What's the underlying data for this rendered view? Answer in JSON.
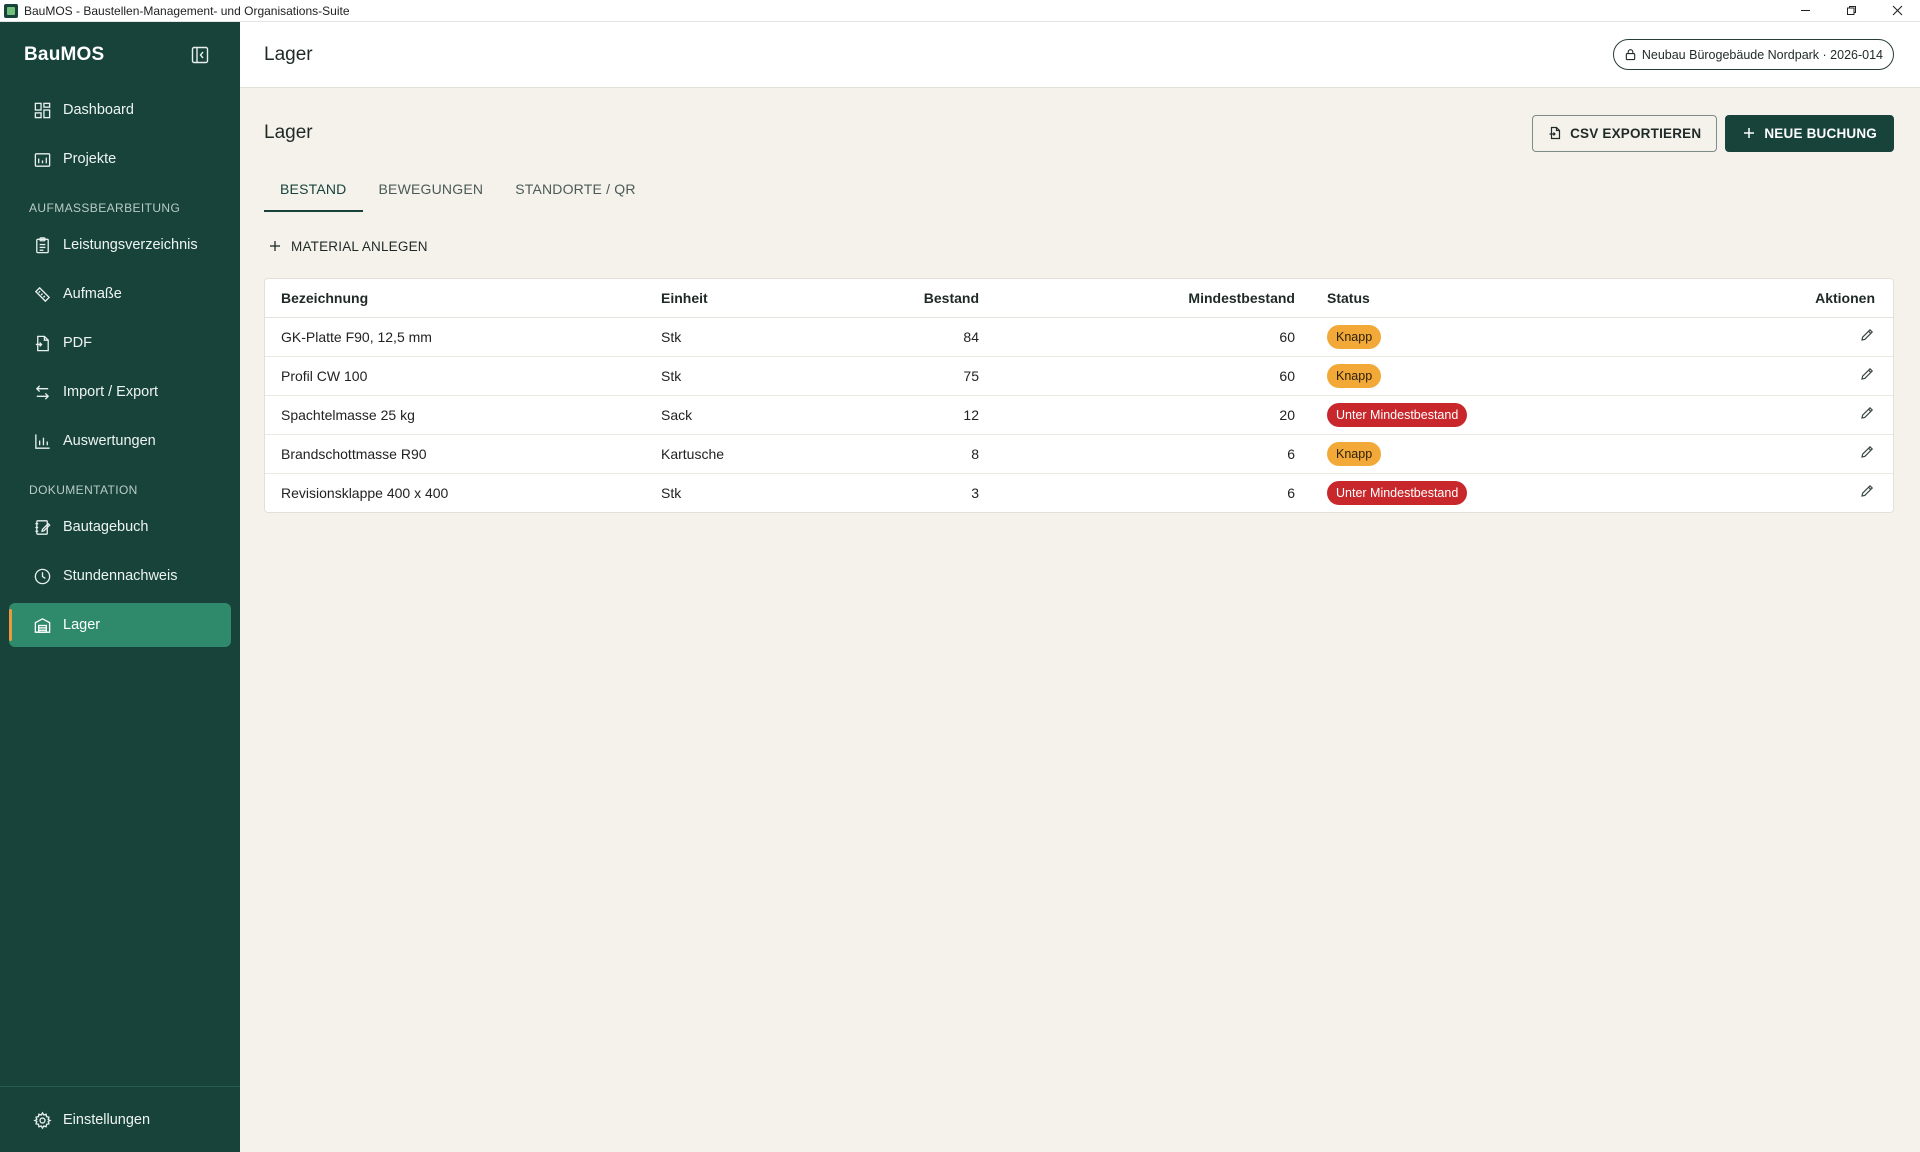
{
  "window": {
    "title": "BauMOS - Baustellen-Management- und Organisations-Suite"
  },
  "sidebar": {
    "brand": "BauMOS",
    "items_top": [
      {
        "label": "Dashboard",
        "icon": "dashboard-icon"
      },
      {
        "label": "Projekte",
        "icon": "projects-icon"
      }
    ],
    "section1": "AUFMASSBEARBEITUNG",
    "items_mid": [
      {
        "label": "Leistungsverzeichnis",
        "icon": "clipboard-icon"
      },
      {
        "label": "Aufmaße",
        "icon": "ruler-icon"
      },
      {
        "label": "PDF",
        "icon": "pdf-file-icon"
      },
      {
        "label": "Import / Export",
        "icon": "swap-arrows-icon"
      },
      {
        "label": "Auswertungen",
        "icon": "bar-chart-icon"
      }
    ],
    "section2": "DOKUMENTATION",
    "items_doc": [
      {
        "label": "Bautagebuch",
        "icon": "journal-icon"
      },
      {
        "label": "Stundennachweis",
        "icon": "clock-icon"
      },
      {
        "label": "Lager",
        "icon": "warehouse-icon",
        "active": true
      }
    ],
    "settings": "Einstellungen"
  },
  "topbar": {
    "title": "Lager",
    "project": "Neubau Bürogebäude Nordpark · 2026-014"
  },
  "page": {
    "title": "Lager",
    "export_label": "CSV EXPORTIEREN",
    "new_booking_label": "NEUE BUCHUNG",
    "tabs": [
      "BESTAND",
      "BEWEGUNGEN",
      "STANDORTE / QR"
    ],
    "active_tab": 0,
    "add_material_label": "MATERIAL ANLEGEN"
  },
  "table": {
    "headers": {
      "name": "Bezeichnung",
      "unit": "Einheit",
      "stock": "Bestand",
      "min": "Mindestbestand",
      "status": "Status",
      "actions": "Aktionen"
    },
    "rows": [
      {
        "name": "GK-Platte F90, 12,5 mm",
        "unit": "Stk",
        "stock": "84",
        "min": "60",
        "status": "Knapp",
        "level": "warn"
      },
      {
        "name": "Profil CW 100",
        "unit": "Stk",
        "stock": "75",
        "min": "60",
        "status": "Knapp",
        "level": "warn"
      },
      {
        "name": "Spachtelmasse 25 kg",
        "unit": "Sack",
        "stock": "12",
        "min": "20",
        "status": "Unter Mindestbestand",
        "level": "danger"
      },
      {
        "name": "Brandschottmasse R90",
        "unit": "Kartusche",
        "stock": "8",
        "min": "6",
        "status": "Knapp",
        "level": "warn"
      },
      {
        "name": "Revisionsklappe 400 x 400",
        "unit": "Stk",
        "stock": "3",
        "min": "6",
        "status": "Unter Mindestbestand",
        "level": "danger"
      }
    ]
  },
  "colors": {
    "sidebar_bg": "#17433b",
    "active_item": "#2f8a6c",
    "accent_bar": "#e89a3c",
    "warn": "#f2a938",
    "danger": "#c8282c",
    "content_bg": "#f5f2ec"
  }
}
